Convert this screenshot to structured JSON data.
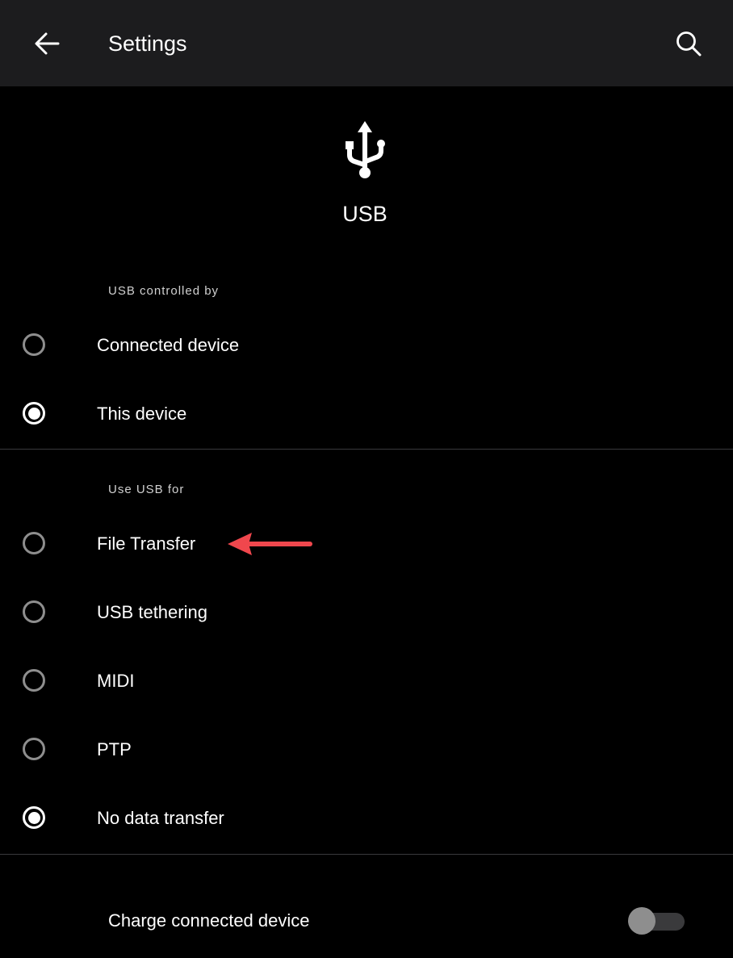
{
  "header": {
    "title": "Settings",
    "back_icon": "arrow-left-icon",
    "search_icon": "search-icon"
  },
  "hero": {
    "icon": "usb-icon",
    "title": "USB"
  },
  "controlled_by": {
    "header": "USB controlled by",
    "options": [
      {
        "label": "Connected device",
        "selected": false
      },
      {
        "label": "This device",
        "selected": true
      }
    ]
  },
  "use_for": {
    "header": "Use USB for",
    "options": [
      {
        "label": "File Transfer",
        "selected": false
      },
      {
        "label": "USB tethering",
        "selected": false
      },
      {
        "label": "MIDI",
        "selected": false
      },
      {
        "label": "PTP",
        "selected": false
      },
      {
        "label": "No data transfer",
        "selected": true
      }
    ]
  },
  "annotation": {
    "icon": "arrow-left-icon",
    "color": "#f0474d"
  },
  "charge": {
    "label": "Charge connected device",
    "enabled": false
  },
  "colors": {
    "background": "#000000",
    "topbar": "#1c1c1e",
    "text": "#ffffff",
    "radio_off": "#8e8e8e",
    "divider": "#3a3a3c"
  }
}
